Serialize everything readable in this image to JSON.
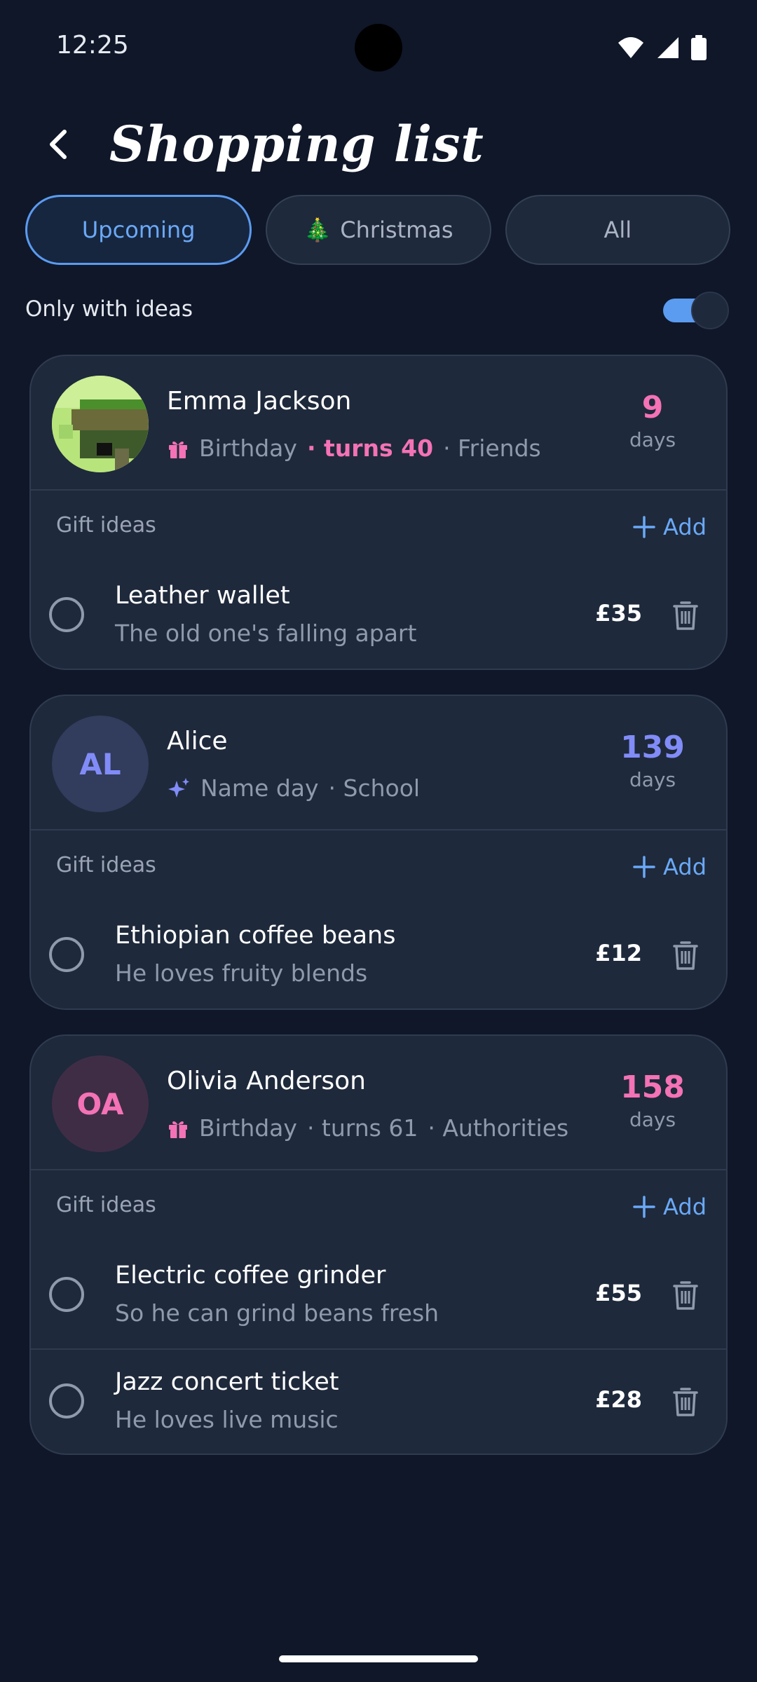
{
  "status_bar": {
    "time": "12:25"
  },
  "header": {
    "title": "Shopping list"
  },
  "tabs": [
    {
      "label": "Upcoming",
      "icon": "",
      "active": true
    },
    {
      "label": "Christmas",
      "icon": "🎄",
      "active": false
    },
    {
      "label": "All",
      "icon": "",
      "active": false
    }
  ],
  "filter": {
    "label": "Only with ideas",
    "on": true
  },
  "gift_ideas_label": "Gift ideas",
  "add_label": "Add",
  "days_label": "days",
  "people": [
    {
      "name": "Emma Jackson",
      "avatar_initials": "",
      "event": "Birthday",
      "event_icon": "gift-icon",
      "turns": "· turns 40",
      "group": "· Friends",
      "days": "9",
      "days_color": "#f472b6",
      "ideas": [
        {
          "title": "Leather wallet",
          "note": "The old one's falling apart",
          "price": "£35"
        }
      ]
    },
    {
      "name": "Alice",
      "avatar_initials": "AL",
      "event": "Name day",
      "event_icon": "sparkles-icon",
      "turns": "",
      "group": "· School",
      "days": "139",
      "days_color": "#818cf8",
      "ideas": [
        {
          "title": "Ethiopian coffee beans",
          "note": "He loves fruity blends",
          "price": "£12"
        }
      ]
    },
    {
      "name": "Olivia Anderson",
      "avatar_initials": "OA",
      "event": "Birthday",
      "event_icon": "gift-icon",
      "turns": "· turns 61",
      "group": "· Authorities",
      "days": "158",
      "days_color": "#f472b6",
      "ideas": [
        {
          "title": "Electric coffee grinder",
          "note": "So he can grind beans fresh",
          "price": "£55"
        },
        {
          "title": "Jazz concert ticket",
          "note": "He loves live music",
          "price": "£28"
        }
      ]
    }
  ]
}
